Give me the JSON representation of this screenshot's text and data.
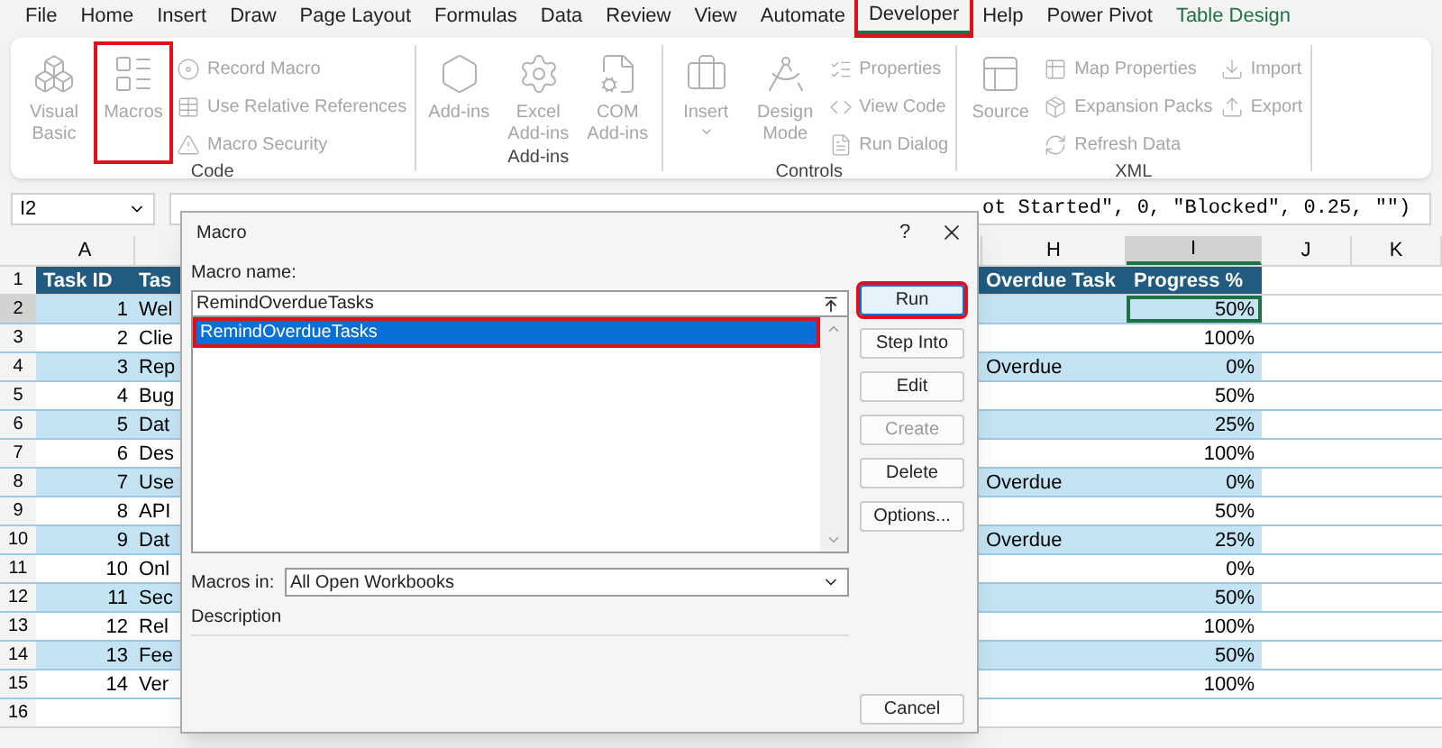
{
  "menu_tabs": [
    {
      "label": "File",
      "selected": false,
      "highlighted": false,
      "kind": "normal"
    },
    {
      "label": "Home",
      "selected": false,
      "highlighted": false,
      "kind": "normal"
    },
    {
      "label": "Insert",
      "selected": false,
      "highlighted": false,
      "kind": "normal"
    },
    {
      "label": "Draw",
      "selected": false,
      "highlighted": false,
      "kind": "normal"
    },
    {
      "label": "Page Layout",
      "selected": false,
      "highlighted": false,
      "kind": "normal"
    },
    {
      "label": "Formulas",
      "selected": false,
      "highlighted": false,
      "kind": "normal"
    },
    {
      "label": "Data",
      "selected": false,
      "highlighted": false,
      "kind": "normal"
    },
    {
      "label": "Review",
      "selected": false,
      "highlighted": false,
      "kind": "normal"
    },
    {
      "label": "View",
      "selected": false,
      "highlighted": false,
      "kind": "normal"
    },
    {
      "label": "Automate",
      "selected": false,
      "highlighted": false,
      "kind": "normal"
    },
    {
      "label": "Developer",
      "selected": true,
      "highlighted": true,
      "kind": "normal"
    },
    {
      "label": "Help",
      "selected": false,
      "highlighted": false,
      "kind": "normal"
    },
    {
      "label": "Power Pivot",
      "selected": false,
      "highlighted": false,
      "kind": "normal"
    },
    {
      "label": "Table Design",
      "selected": false,
      "highlighted": false,
      "kind": "contextual"
    }
  ],
  "ribbon": {
    "groups": [
      {
        "label": "Code",
        "items": [
          {
            "kind": "large",
            "label": "Visual Basic",
            "disabled": true,
            "highlighted": false
          },
          {
            "kind": "large",
            "label": "Macros",
            "disabled": true,
            "highlighted": true
          },
          {
            "kind": "small",
            "label": "Record Macro",
            "disabled": true,
            "highlighted": false
          },
          {
            "kind": "small",
            "label": "Use Relative References",
            "disabled": true,
            "highlighted": false
          },
          {
            "kind": "small",
            "label": "Macro Security",
            "disabled": true,
            "highlighted": false
          }
        ]
      },
      {
        "label": "Add-ins",
        "items": [
          {
            "kind": "large",
            "label": "Add-ins",
            "disabled": true,
            "highlighted": false
          },
          {
            "kind": "large",
            "label": "Excel Add-ins",
            "disabled": true,
            "highlighted": false
          },
          {
            "kind": "large",
            "label": "COM Add-ins",
            "disabled": true,
            "highlighted": false
          }
        ]
      },
      {
        "label": "Controls",
        "items": [
          {
            "kind": "large",
            "label": "Insert",
            "disabled": true,
            "highlighted": false,
            "dropdown": true
          },
          {
            "kind": "large",
            "label": "Design Mode",
            "disabled": true,
            "highlighted": false
          },
          {
            "kind": "small",
            "label": "Properties",
            "disabled": true,
            "highlighted": false
          },
          {
            "kind": "small",
            "label": "View Code",
            "disabled": true,
            "highlighted": false
          },
          {
            "kind": "small",
            "label": "Run Dialog",
            "disabled": true,
            "highlighted": false
          }
        ]
      },
      {
        "label": "XML",
        "items": [
          {
            "kind": "large",
            "label": "Source",
            "disabled": true,
            "highlighted": false
          },
          {
            "kind": "small",
            "label": "Map Properties",
            "disabled": true,
            "highlighted": false
          },
          {
            "kind": "small",
            "label": "Expansion Packs",
            "disabled": true,
            "highlighted": false
          },
          {
            "kind": "small",
            "label": "Refresh Data",
            "disabled": true,
            "highlighted": false
          },
          {
            "kind": "small",
            "label": "Import",
            "disabled": true,
            "highlighted": false
          },
          {
            "kind": "small",
            "label": "Export",
            "disabled": true,
            "highlighted": false
          }
        ]
      }
    ]
  },
  "formula_bar": {
    "name_box": "I2",
    "formula": "ot Started\", 0, \"Blocked\", 0.25, \"\")"
  },
  "sheet": {
    "columns": [
      {
        "letter": "A",
        "selected": false
      },
      {
        "letter": "H",
        "selected": false
      },
      {
        "letter": "I",
        "selected": true
      },
      {
        "letter": "J",
        "selected": false
      },
      {
        "letter": "K",
        "selected": false
      }
    ],
    "header_row": {
      "number": "1",
      "task_id": "Task ID",
      "task": "Tas",
      "overdue": "Overdue Task",
      "progress": "Progress %"
    },
    "rows": [
      {
        "number": "2",
        "task_id": "1",
        "task": "Wel",
        "progress": "50%",
        "selected": true
      },
      {
        "number": "3",
        "task_id": "2",
        "task": "Clie",
        "progress": "100%",
        "selected": false
      },
      {
        "number": "4",
        "task_id": "3",
        "task": "Rep",
        "overdue": "Overdue",
        "progress": "0%",
        "selected": false
      },
      {
        "number": "5",
        "task_id": "4",
        "task": "Bug",
        "progress": "50%",
        "selected": false
      },
      {
        "number": "6",
        "task_id": "5",
        "task": "Dat",
        "progress": "25%",
        "selected": false
      },
      {
        "number": "7",
        "task_id": "6",
        "task": "Des",
        "progress": "100%",
        "selected": false
      },
      {
        "number": "8",
        "task_id": "7",
        "task": "Use",
        "overdue": "Overdue",
        "progress": "0%",
        "selected": false
      },
      {
        "number": "9",
        "task_id": "8",
        "task": "API",
        "progress": "50%",
        "selected": false
      },
      {
        "number": "10",
        "task_id": "9",
        "task": "Dat",
        "overdue": "Overdue",
        "progress": "25%",
        "selected": false
      },
      {
        "number": "11",
        "task_id": "10",
        "task": "Onl",
        "progress": "0%",
        "selected": false
      },
      {
        "number": "12",
        "task_id": "11",
        "task": "Sec",
        "progress": "50%",
        "selected": false
      },
      {
        "number": "13",
        "task_id": "12",
        "task": "Rel",
        "progress": "100%",
        "selected": false
      },
      {
        "number": "14",
        "task_id": "13",
        "task": "Fee",
        "progress": "50%",
        "selected": false
      },
      {
        "number": "15",
        "task_id": "14",
        "task": "Ver",
        "progress": "100%",
        "selected": false
      }
    ],
    "blank_rows": [
      "16"
    ]
  },
  "dialog": {
    "title": "Macro",
    "help": "?",
    "name_label": "Macro name:",
    "name_value": "RemindOverdueTasks",
    "macros": [
      {
        "label": "RemindOverdueTasks",
        "selected": true,
        "highlighted": true
      }
    ],
    "macros_in_label": "Macros in:",
    "macros_in_value": "All Open Workbooks",
    "description_label": "Description",
    "buttons": [
      {
        "label": "Run",
        "disabled": false,
        "highlighted": true,
        "kind": "default"
      },
      {
        "label": "Step Into",
        "disabled": false,
        "highlighted": false,
        "kind": "normal"
      },
      {
        "label": "Edit",
        "disabled": false,
        "highlighted": false,
        "kind": "normal"
      },
      {
        "label": "Create",
        "disabled": true,
        "highlighted": false,
        "kind": "normal"
      },
      {
        "label": "Delete",
        "disabled": false,
        "highlighted": false,
        "kind": "normal"
      },
      {
        "label": "Options...",
        "disabled": false,
        "highlighted": false,
        "kind": "normal"
      },
      {
        "label": "Cancel",
        "disabled": false,
        "highlighted": false,
        "kind": "cancel"
      }
    ]
  }
}
